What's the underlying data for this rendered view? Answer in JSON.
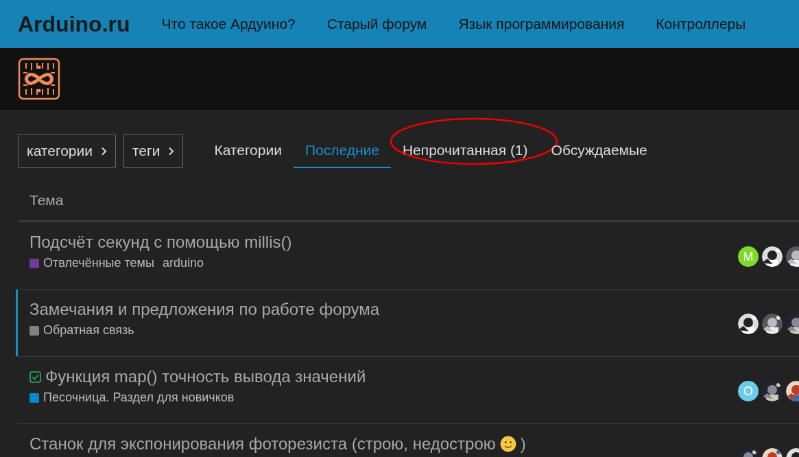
{
  "top_bar": {
    "brand": "Arduino.ru",
    "links": [
      "Что такое Ардуино?",
      "Старый форум",
      "Язык программирования",
      "Контроллеры"
    ]
  },
  "filters": [
    {
      "label": "категории"
    },
    {
      "label": "теги"
    }
  ],
  "tabs": [
    {
      "label": "Категории",
      "selected": false,
      "circled": false
    },
    {
      "label": "Последние",
      "selected": true,
      "circled": false
    },
    {
      "label": "Непрочитанная (1)",
      "selected": false,
      "circled": true
    },
    {
      "label": "Обсуждаемые",
      "selected": false,
      "circled": false
    }
  ],
  "table": {
    "column_1": "Тема",
    "rows": [
      {
        "title": "Подсчёт секунд с помощью millis()",
        "solved": false,
        "highlighted": false,
        "category": {
          "name": "Отвлечённые темы",
          "color": "#6e3a9e"
        },
        "tag": "arduino",
        "avatars": [
          {
            "kind": "letter",
            "letter": "M",
            "color": "#7fdb2a"
          },
          {
            "kind": "picture"
          },
          {
            "kind": "picture"
          }
        ]
      },
      {
        "title": "Замечания и предложения по работе форума",
        "solved": false,
        "highlighted": true,
        "category": {
          "name": "Обратная связь",
          "color": "#808281"
        },
        "avatars": [
          {
            "kind": "picture"
          },
          {
            "kind": "picture"
          },
          {
            "kind": "picture"
          }
        ]
      },
      {
        "title": "Функция map() точность вывода значений",
        "solved": true,
        "highlighted": false,
        "category": {
          "name": "Песочница. Раздел для новичков",
          "color": "#0088cc"
        },
        "avatars": [
          {
            "kind": "letter",
            "letter": "O",
            "color": "#6ccbe8"
          },
          {
            "kind": "picture"
          },
          {
            "kind": "picture"
          }
        ]
      },
      {
        "title_parts": [
          {
            "kind": "text",
            "text": "Станок для экспонирования фоторезиста (строю, недострою"
          },
          {
            "kind": "smiley"
          },
          {
            "kind": "text",
            "text": ")"
          }
        ],
        "solved": false,
        "highlighted": false,
        "avatars": [
          {
            "kind": "picture"
          },
          {
            "kind": "picture"
          },
          {
            "kind": "picture"
          }
        ]
      }
    ]
  }
}
